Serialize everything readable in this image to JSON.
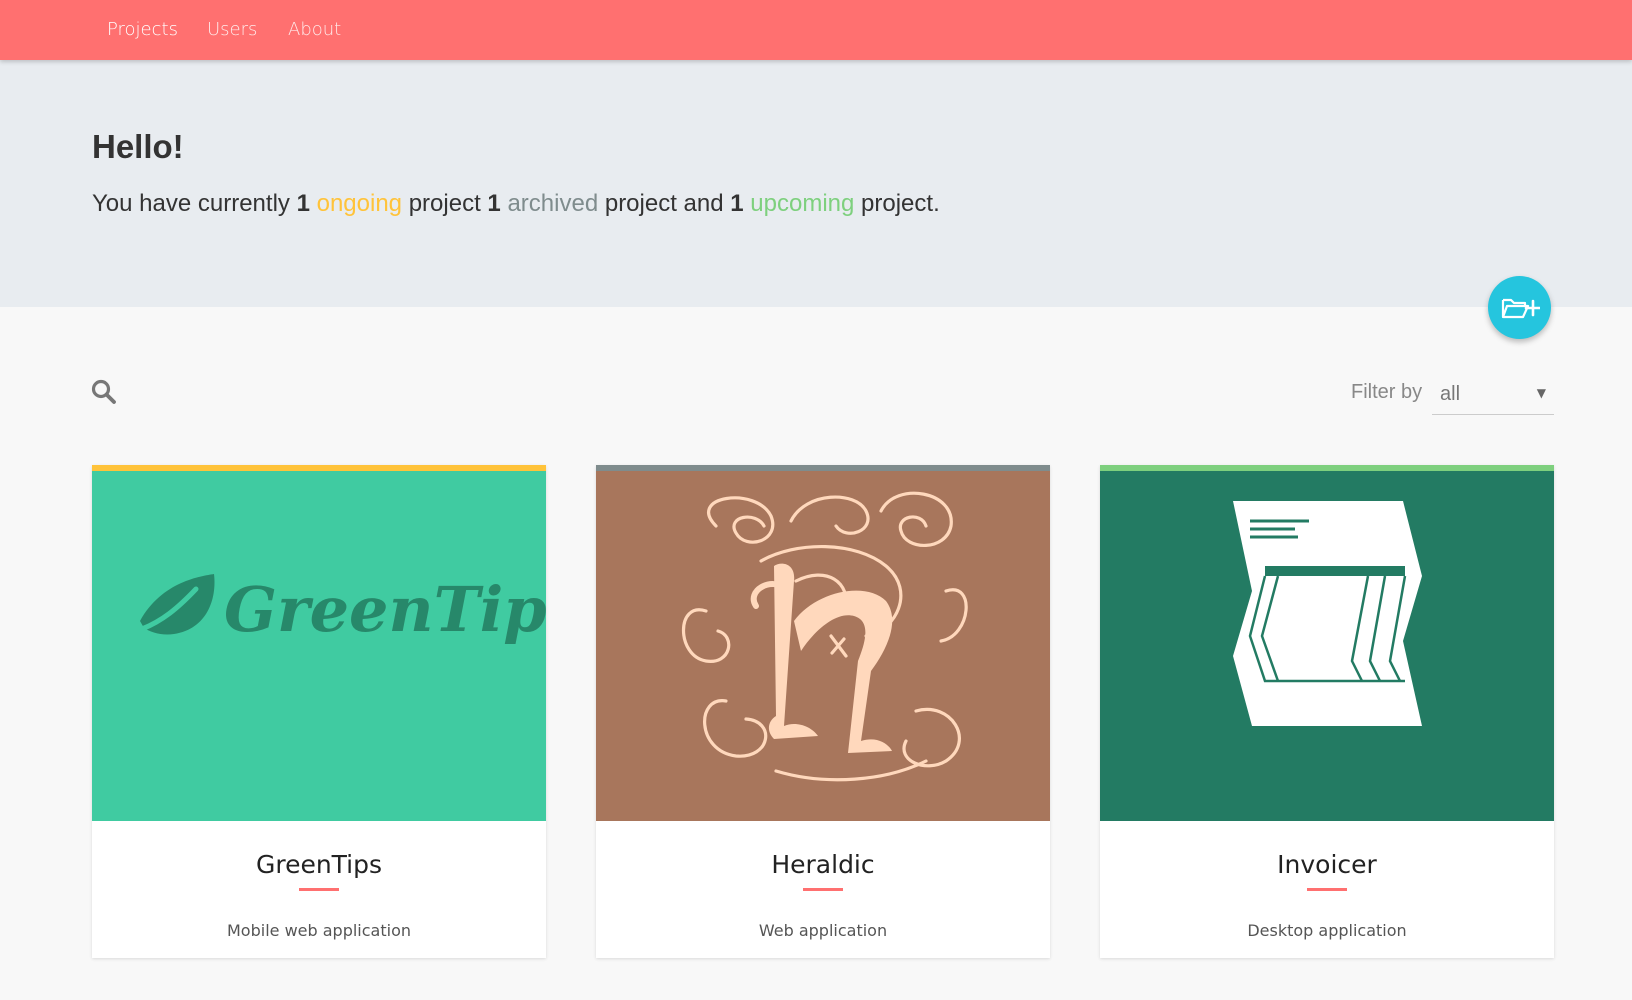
{
  "nav": {
    "items": [
      {
        "label": "Projects"
      },
      {
        "label": "Users"
      },
      {
        "label": "About"
      }
    ]
  },
  "hero": {
    "greeting": "Hello!",
    "summary": {
      "prefix": "You have currently",
      "ongoing_count": "1",
      "ongoing_label": "ongoing",
      "between1": "project",
      "archived_count": "1",
      "archived_label": "archived",
      "between2": "project and",
      "upcoming_count": "1",
      "upcoming_label": "upcoming",
      "suffix": "project."
    }
  },
  "toolbar": {
    "search_icon": "search-icon",
    "filter_label": "Filter by",
    "filter_value": "all",
    "add_project_icon": "folder-plus-icon"
  },
  "colors": {
    "nav": "#ff7070",
    "ongoing": "#ffc33a",
    "archived": "#7f8c8d",
    "upcoming": "#7ed07e",
    "fab": "#25c5de",
    "accent_underline": "#ff7070"
  },
  "projects": [
    {
      "title": "GreenTips",
      "subtitle": "Mobile web application",
      "status_color": "#ffc33a",
      "image_bg": "#40cba1",
      "logo_text": "GreenTips"
    },
    {
      "title": "Heraldic",
      "subtitle": "Web application",
      "status_color": "#7f8c8d",
      "image_bg": "#a8765c"
    },
    {
      "title": "Invoicer",
      "subtitle": "Desktop application",
      "status_color": "#7ed07e",
      "image_bg": "#237b63"
    }
  ]
}
